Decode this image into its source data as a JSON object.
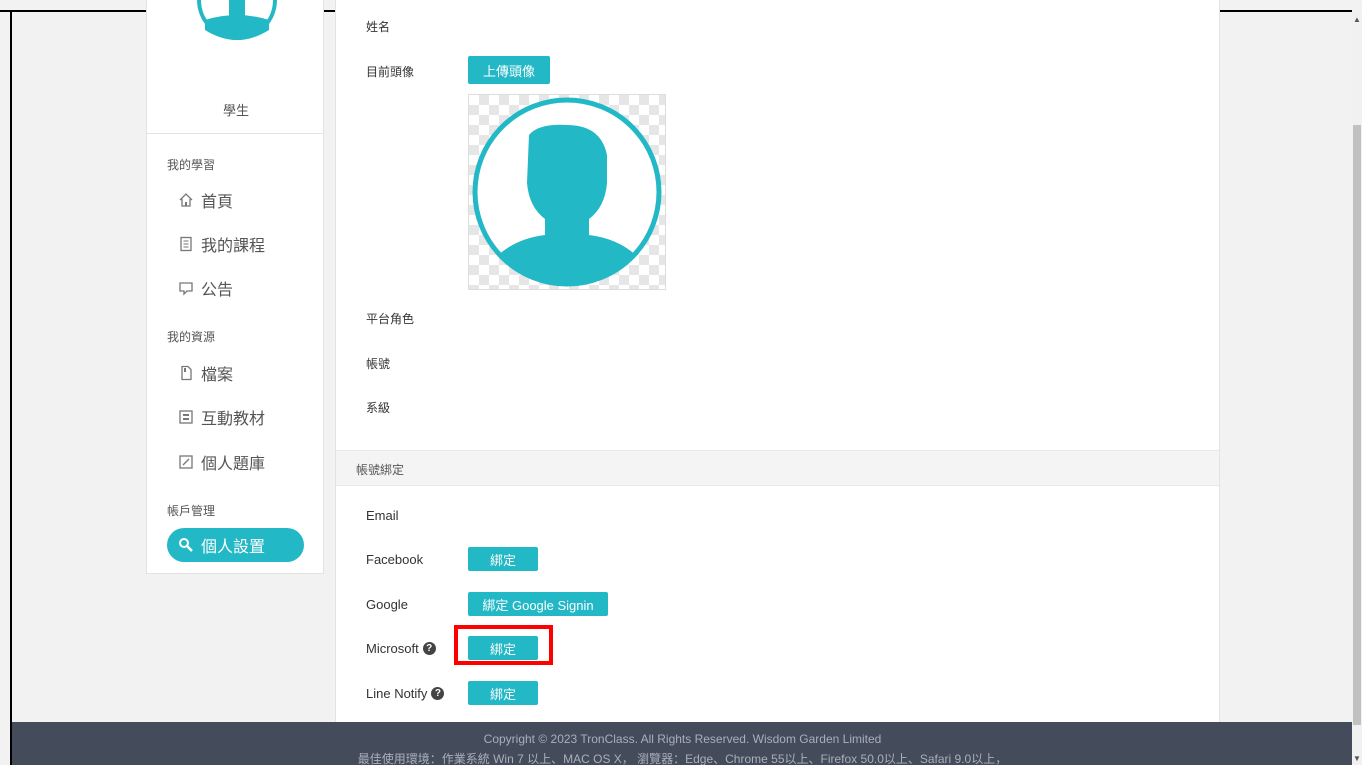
{
  "sidebar": {
    "role": "學生",
    "sections": {
      "learning": "我的學習",
      "resources": "我的資源",
      "account": "帳戶管理"
    },
    "items": [
      {
        "label": "首頁",
        "icon": "home-icon"
      },
      {
        "label": "我的課程",
        "icon": "course-icon"
      },
      {
        "label": "公告",
        "icon": "announcement-icon"
      },
      {
        "label": "檔案",
        "icon": "file-icon"
      },
      {
        "label": "互動教材",
        "icon": "interactive-material-icon"
      },
      {
        "label": "個人題庫",
        "icon": "question-bank-icon"
      },
      {
        "label": "個人設置",
        "icon": "wrench-icon"
      }
    ]
  },
  "profile": {
    "name_label": "姓名",
    "avatar_label": "目前頭像",
    "upload_button": "上傳頭像",
    "role_label": "平台角色",
    "account_label": "帳號",
    "department_label": "系級"
  },
  "binding": {
    "section_title": "帳號綁定",
    "email_label": "Email",
    "facebook_label": "Facebook",
    "facebook_button": "綁定",
    "google_label": "Google",
    "google_button": "綁定 Google Signin",
    "microsoft_label": "Microsoft",
    "microsoft_button": "綁定",
    "line_label": "Line Notify",
    "line_button": "綁定"
  },
  "footer": {
    "copyright": "Copyright © 2023 TronClass. All Rights Reserved. Wisdom Garden Limited",
    "environment": "最佳使用環境：作業系統 Win 7 以上、MAC OS X， 瀏覽器：Edge、Chrome 55以上、Firefox 50.0以上、Safari 9.0以上，"
  },
  "colors": {
    "accent": "#23b8c6",
    "footer_bg": "#444b5a",
    "highlight_box": "#ff0000"
  }
}
